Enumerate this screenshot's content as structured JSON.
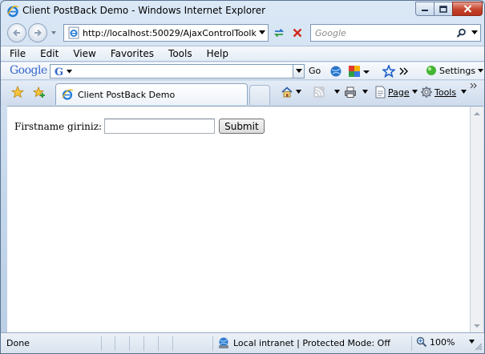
{
  "window": {
    "title": "Client PostBack Demo - Windows Internet Explorer"
  },
  "navigation": {
    "url": "http://localhost:50029/AjaxControlToolkit/Clie",
    "search_placeholder": "Google"
  },
  "menu": {
    "items": [
      "File",
      "Edit",
      "View",
      "Favorites",
      "Tools",
      "Help"
    ]
  },
  "google_toolbar": {
    "logo": "Google",
    "go_label": "Go",
    "settings_label": "Settings"
  },
  "tabs": {
    "active_label": "Client PostBack Demo",
    "page_label": "Page",
    "tools_label": "Tools"
  },
  "content": {
    "form_label": "Firstname giriniz:",
    "input_value": "",
    "submit_label": "Submit"
  },
  "status": {
    "text": "Done",
    "zone": "Local intranet | Protected Mode: Off",
    "zoom": "100%"
  },
  "colors": {
    "chrome": "#c9dcee",
    "close_button": "#c4432c",
    "google_blue": "#3366cc",
    "accent_blue": "#1f5fc7"
  }
}
